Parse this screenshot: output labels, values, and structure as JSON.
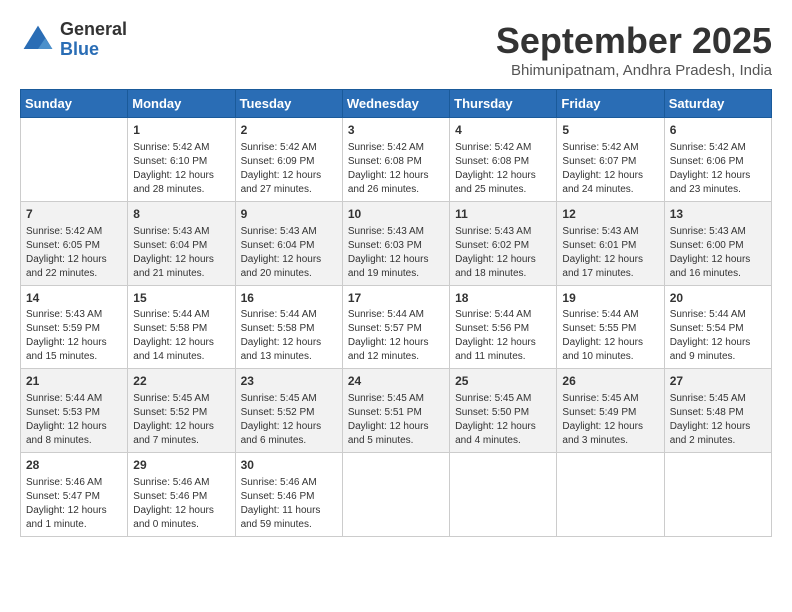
{
  "header": {
    "logo_general": "General",
    "logo_blue": "Blue",
    "month": "September 2025",
    "location": "Bhimunipatnam, Andhra Pradesh, India"
  },
  "days_of_week": [
    "Sunday",
    "Monday",
    "Tuesday",
    "Wednesday",
    "Thursday",
    "Friday",
    "Saturday"
  ],
  "weeks": [
    [
      {
        "day": "",
        "info": ""
      },
      {
        "day": "1",
        "info": "Sunrise: 5:42 AM\nSunset: 6:10 PM\nDaylight: 12 hours\nand 28 minutes."
      },
      {
        "day": "2",
        "info": "Sunrise: 5:42 AM\nSunset: 6:09 PM\nDaylight: 12 hours\nand 27 minutes."
      },
      {
        "day": "3",
        "info": "Sunrise: 5:42 AM\nSunset: 6:08 PM\nDaylight: 12 hours\nand 26 minutes."
      },
      {
        "day": "4",
        "info": "Sunrise: 5:42 AM\nSunset: 6:08 PM\nDaylight: 12 hours\nand 25 minutes."
      },
      {
        "day": "5",
        "info": "Sunrise: 5:42 AM\nSunset: 6:07 PM\nDaylight: 12 hours\nand 24 minutes."
      },
      {
        "day": "6",
        "info": "Sunrise: 5:42 AM\nSunset: 6:06 PM\nDaylight: 12 hours\nand 23 minutes."
      }
    ],
    [
      {
        "day": "7",
        "info": "Sunrise: 5:42 AM\nSunset: 6:05 PM\nDaylight: 12 hours\nand 22 minutes."
      },
      {
        "day": "8",
        "info": "Sunrise: 5:43 AM\nSunset: 6:04 PM\nDaylight: 12 hours\nand 21 minutes."
      },
      {
        "day": "9",
        "info": "Sunrise: 5:43 AM\nSunset: 6:04 PM\nDaylight: 12 hours\nand 20 minutes."
      },
      {
        "day": "10",
        "info": "Sunrise: 5:43 AM\nSunset: 6:03 PM\nDaylight: 12 hours\nand 19 minutes."
      },
      {
        "day": "11",
        "info": "Sunrise: 5:43 AM\nSunset: 6:02 PM\nDaylight: 12 hours\nand 18 minutes."
      },
      {
        "day": "12",
        "info": "Sunrise: 5:43 AM\nSunset: 6:01 PM\nDaylight: 12 hours\nand 17 minutes."
      },
      {
        "day": "13",
        "info": "Sunrise: 5:43 AM\nSunset: 6:00 PM\nDaylight: 12 hours\nand 16 minutes."
      }
    ],
    [
      {
        "day": "14",
        "info": "Sunrise: 5:43 AM\nSunset: 5:59 PM\nDaylight: 12 hours\nand 15 minutes."
      },
      {
        "day": "15",
        "info": "Sunrise: 5:44 AM\nSunset: 5:58 PM\nDaylight: 12 hours\nand 14 minutes."
      },
      {
        "day": "16",
        "info": "Sunrise: 5:44 AM\nSunset: 5:58 PM\nDaylight: 12 hours\nand 13 minutes."
      },
      {
        "day": "17",
        "info": "Sunrise: 5:44 AM\nSunset: 5:57 PM\nDaylight: 12 hours\nand 12 minutes."
      },
      {
        "day": "18",
        "info": "Sunrise: 5:44 AM\nSunset: 5:56 PM\nDaylight: 12 hours\nand 11 minutes."
      },
      {
        "day": "19",
        "info": "Sunrise: 5:44 AM\nSunset: 5:55 PM\nDaylight: 12 hours\nand 10 minutes."
      },
      {
        "day": "20",
        "info": "Sunrise: 5:44 AM\nSunset: 5:54 PM\nDaylight: 12 hours\nand 9 minutes."
      }
    ],
    [
      {
        "day": "21",
        "info": "Sunrise: 5:44 AM\nSunset: 5:53 PM\nDaylight: 12 hours\nand 8 minutes."
      },
      {
        "day": "22",
        "info": "Sunrise: 5:45 AM\nSunset: 5:52 PM\nDaylight: 12 hours\nand 7 minutes."
      },
      {
        "day": "23",
        "info": "Sunrise: 5:45 AM\nSunset: 5:52 PM\nDaylight: 12 hours\nand 6 minutes."
      },
      {
        "day": "24",
        "info": "Sunrise: 5:45 AM\nSunset: 5:51 PM\nDaylight: 12 hours\nand 5 minutes."
      },
      {
        "day": "25",
        "info": "Sunrise: 5:45 AM\nSunset: 5:50 PM\nDaylight: 12 hours\nand 4 minutes."
      },
      {
        "day": "26",
        "info": "Sunrise: 5:45 AM\nSunset: 5:49 PM\nDaylight: 12 hours\nand 3 minutes."
      },
      {
        "day": "27",
        "info": "Sunrise: 5:45 AM\nSunset: 5:48 PM\nDaylight: 12 hours\nand 2 minutes."
      }
    ],
    [
      {
        "day": "28",
        "info": "Sunrise: 5:46 AM\nSunset: 5:47 PM\nDaylight: 12 hours\nand 1 minute."
      },
      {
        "day": "29",
        "info": "Sunrise: 5:46 AM\nSunset: 5:46 PM\nDaylight: 12 hours\nand 0 minutes."
      },
      {
        "day": "30",
        "info": "Sunrise: 5:46 AM\nSunset: 5:46 PM\nDaylight: 11 hours\nand 59 minutes."
      },
      {
        "day": "",
        "info": ""
      },
      {
        "day": "",
        "info": ""
      },
      {
        "day": "",
        "info": ""
      },
      {
        "day": "",
        "info": ""
      }
    ]
  ]
}
